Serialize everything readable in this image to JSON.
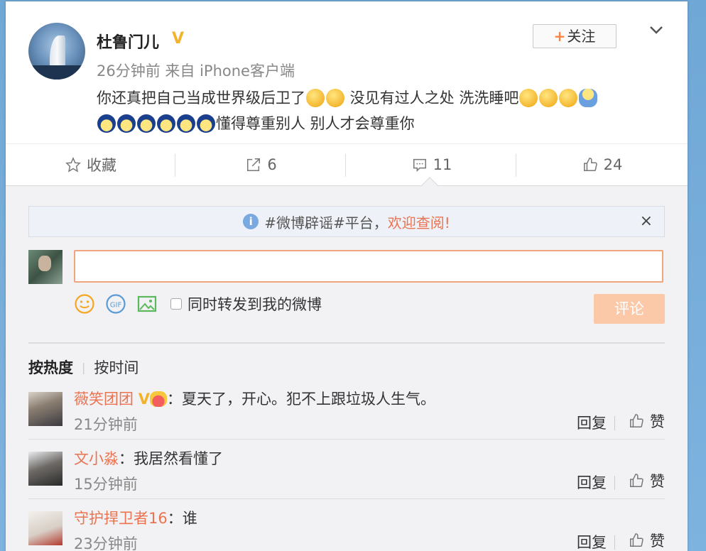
{
  "post": {
    "username": "杜鲁门儿",
    "verified_badge": "V",
    "meta": "26分钟前 来自 iPhone客户端",
    "follow_plus": "+",
    "follow_label": "关注",
    "text_part1": "你还真把自己当成世界级后卫了",
    "text_part2": " 没见有过人之处 洗洗睡吧",
    "text_part3": "懂得尊重别人 别人才会尊重你",
    "icon_menu": "chevron-down-icon"
  },
  "actions": {
    "favorite_label": "收藏",
    "repost_count": "6",
    "comment_count": "11",
    "like_count": "24"
  },
  "notice": {
    "text": "#微博辟谣#平台，",
    "link": "欢迎查阅!",
    "info_glyph": "i",
    "close_glyph": "×"
  },
  "composer": {
    "input_value": "",
    "input_placeholder": "",
    "sync_label": "同时转发到我的微博",
    "submit_label": "评论"
  },
  "sort": {
    "active": "按热度",
    "other": "按时间"
  },
  "comments": [
    {
      "user": "薇笑团团",
      "verified": "V",
      "text": "：夏天了，开心。犯不上跟垃圾人生气。",
      "time": "21分钟前",
      "reply": "回复",
      "like": "赞"
    },
    {
      "user": "文小淼",
      "text": "：我居然看懂了",
      "time": "15分钟前",
      "reply": "回复",
      "like": "赞"
    },
    {
      "user": "守护捍卫者16",
      "text": "：谁",
      "time": "23分钟前",
      "reply": "回复",
      "like": "赞"
    }
  ],
  "colors": {
    "accent": "#eb7350",
    "submit_disabled": "#fbc9a8",
    "verified": "#f2b32a",
    "background": "#7db3df"
  }
}
